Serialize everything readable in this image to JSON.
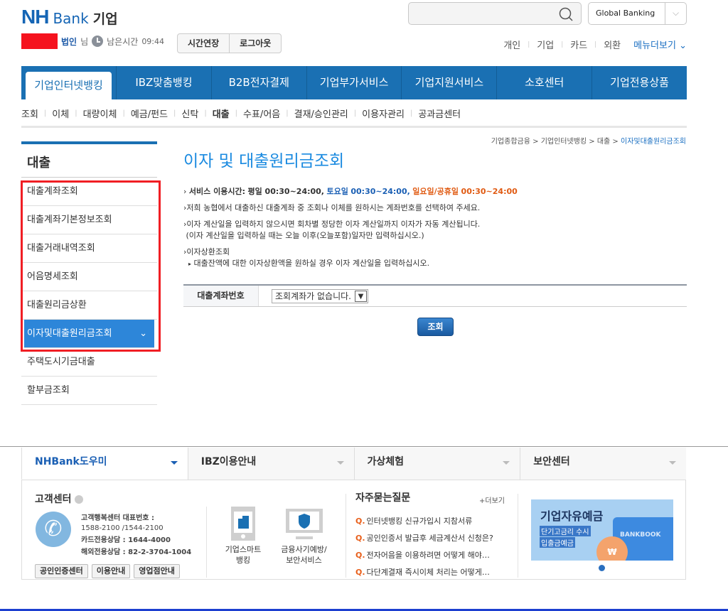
{
  "header": {
    "logo_nh": "NH",
    "logo_bank": "Bank",
    "logo_sub": "기업",
    "user_suffix": "법인",
    "honorific": "님",
    "remaining_label": "남은시간",
    "remaining_time": "09:44",
    "extend_btn": "시간연장",
    "logout_btn": "로그아웃",
    "search_placeholder": "",
    "global_banking": "Global Banking",
    "links": [
      "개인",
      "기업",
      "카드",
      "외환"
    ],
    "menu_more": "메뉴더보기"
  },
  "gnb": [
    "기업인터넷뱅킹",
    "IBZ맞춤뱅킹",
    "B2B전자결제",
    "기업부가서비스",
    "기업지원서비스",
    "소호센터",
    "기업전용상품"
  ],
  "lnb": [
    "조회",
    "이체",
    "대량이체",
    "예금/펀드",
    "신탁",
    "대출",
    "수표/어음",
    "결재/승인관리",
    "이용자관리",
    "공과금센터"
  ],
  "sidebar": {
    "title": "대출",
    "items": [
      "대출계좌조회",
      "대출계좌기본정보조회",
      "대출거래내역조회",
      "어음명세조회",
      "대출원리금상환",
      "이자및대출원리금조회",
      "주택도시기금대출",
      "할부금조회"
    ]
  },
  "breadcrumb": [
    "기업종합금융",
    "기업인터넷뱅킹",
    "대출",
    "이자및대출원리금조회"
  ],
  "page_title": "이자 및 대출원리금조회",
  "info": {
    "svc_label": "서비스 이용시간:",
    "weekday": "평일 00:30~24:00,",
    "sat_label": "토요일",
    "sat_time": "00:30~24:00,",
    "sun_label": "일요일/공휴일",
    "sun_time": "00:30~24:00",
    "line2": "저희 농협에서 대출하신 대출계좌 중 조회나 이체를 원하시는 계좌번호를 선택하여 주세요.",
    "line3": "이자 계산일을 입력하지 않으시면 회차별 정당한 이자 계산일까지 이자가 자동 계산됩니다.",
    "line3b": "(이자 계산일을 입력하실 때는 오늘 이후(오늘포함)일자만 입력하십시오.)",
    "line4": "이자상환조회",
    "line4b": "대출잔액에 대한 이자상환액을 원하실 경우 이자 계산일을 입력하십시오."
  },
  "form": {
    "label": "대출계좌번호",
    "select_value": "조회계좌가 없습니다.",
    "submit": "조회"
  },
  "footer": {
    "tabs": [
      "NHBank도우미",
      "IBZ이용안내",
      "가상체험",
      "보안센터"
    ],
    "cc_title": "고객센터",
    "cc_rep_label": "고객행복센터 대표번호 :",
    "cc_rep": "1588-2100 /1544-2100",
    "cc_card": "카드전용상담 : 1644-4000",
    "cc_overseas": "해외전용상담 : 82-2-3704-1004",
    "cc_buttons": [
      "공인인증센터",
      "이용안내",
      "영업점안내"
    ],
    "app1": [
      "기업스마트",
      "뱅킹"
    ],
    "app2": [
      "금융사기예방/",
      "보안서비스"
    ],
    "faq_title": "자주묻는질문",
    "faq_more": "+더보기",
    "faq": [
      "인터넷뱅킹 신규가입시 지참서류",
      "공인인증서 발급후 세금계산서 신청은?",
      "전자어음을 이용하려면 어떻게 해야…",
      "다단계결재 즉시이체 처리는 어떻게…"
    ],
    "faq_q": "Q.",
    "banner_title": "기업자유예금",
    "banner_tag1": "단기고금리 수시",
    "banner_tag2": "입출금예금",
    "banner_book": "BANKBOOK",
    "banner_won": "₩"
  }
}
